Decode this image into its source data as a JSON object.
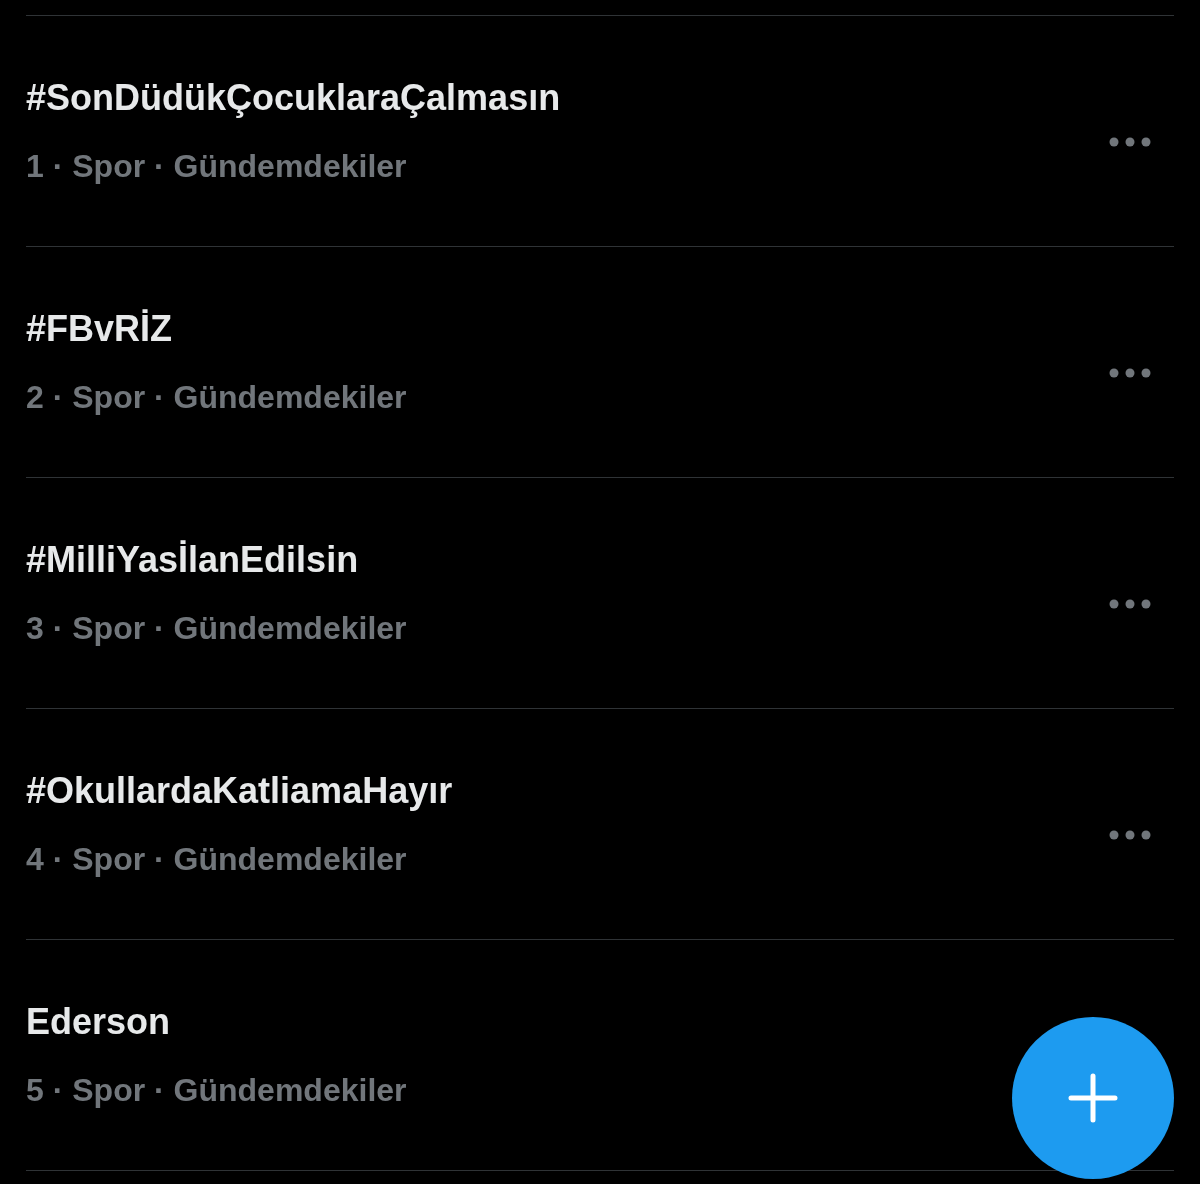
{
  "trends": [
    {
      "title": "#SonDüdükÇocuklaraÇalmasın",
      "meta": "1 · Spor · Gündemdekiler"
    },
    {
      "title": "#FBvRİZ",
      "meta": "2 · Spor · Gündemdekiler"
    },
    {
      "title": "#MilliYasİlanEdilsin",
      "meta": "3 · Spor · Gündemdekiler"
    },
    {
      "title": "#OkullardaKatliamaHayır",
      "meta": "4 · Spor · Gündemdekiler"
    },
    {
      "title": "Ederson",
      "meta": "5 · Spor · Gündemdekiler"
    }
  ],
  "compose_button": {
    "visible": true
  }
}
